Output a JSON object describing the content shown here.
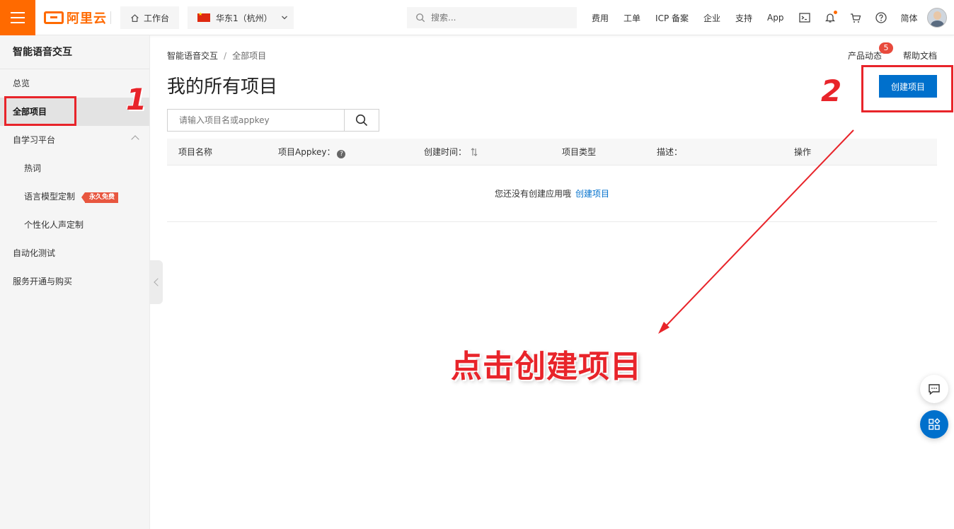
{
  "topbar": {
    "logo_text": "阿里云",
    "workbench_label": "工作台",
    "region_label": "华东1（杭州）",
    "search_placeholder": "搜索...",
    "nav_items": [
      "费用",
      "工单",
      "ICP 备案",
      "企业",
      "支持",
      "App"
    ],
    "lang_label": "简体",
    "icons": [
      "terminal-icon",
      "bell-icon",
      "cart-icon",
      "help-icon"
    ],
    "accent_color": "#ff6a00"
  },
  "sidebar": {
    "title": "智能语音交互",
    "items": [
      {
        "label": "总览"
      },
      {
        "label": "全部项目"
      },
      {
        "label": "自学习平台"
      },
      {
        "label": "热词"
      },
      {
        "label": "语言模型定制",
        "badge": "永久免费"
      },
      {
        "label": "个性化人声定制"
      },
      {
        "label": "自动化测试"
      },
      {
        "label": "服务开通与购买"
      }
    ]
  },
  "main": {
    "breadcrumb": [
      "智能语音交互",
      "全部项目"
    ],
    "product_news_label": "产品动态",
    "product_news_count": "5",
    "help_docs_label": "帮助文档",
    "page_title": "我的所有项目",
    "create_button_label": "创建项目",
    "search_placeholder": "请输入项目名或appkey",
    "table": {
      "columns": [
        "项目名称",
        "项目Appkey：",
        "创建时间：",
        "项目类型",
        "描述：",
        "操作"
      ],
      "empty_text": "您还没有创建应用哦",
      "empty_link": "创建项目"
    }
  },
  "annotations": {
    "step1": "1",
    "step2": "2",
    "instruction": "点击创建项目",
    "color": "#e8242a"
  }
}
